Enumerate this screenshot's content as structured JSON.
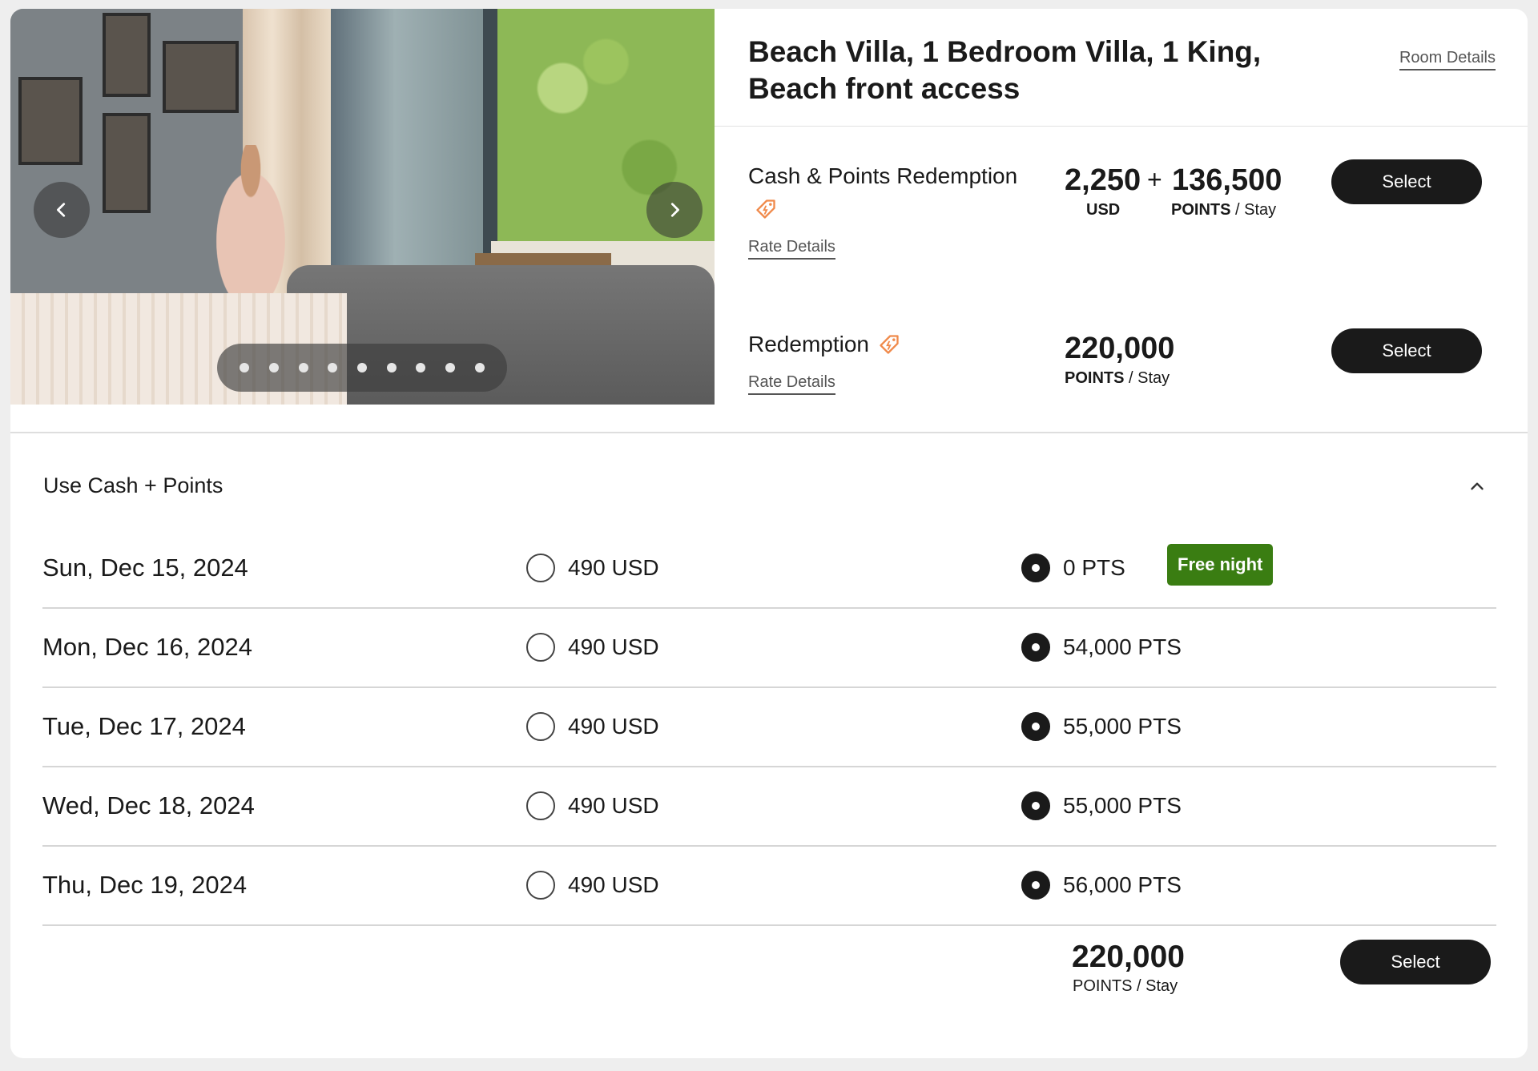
{
  "room": {
    "title_line1": "Beach Villa, 1 Bedroom Villa, 1 King,",
    "title_line2": "Beach front access",
    "details_link": "Room Details"
  },
  "carousel": {
    "prev_icon": "chevron-left-icon",
    "next_icon": "chevron-right-icon",
    "dot_count": 9
  },
  "rates": [
    {
      "name": "Cash & Points Redemption",
      "link": "Rate Details",
      "cash_amount": "2,250",
      "cash_unit": "USD",
      "plus": "+",
      "points_amount": "136,500",
      "points_unit": "POINTS",
      "per": "/ Stay",
      "button": "Select"
    },
    {
      "name": "Redemption",
      "link": "Rate Details",
      "points_amount": "220,000",
      "points_unit": "POINTS",
      "per": "/ Stay",
      "button": "Select"
    }
  ],
  "cash_points": {
    "title": "Use Cash + Points",
    "toggle_icon": "chevron-up-icon",
    "nights": [
      {
        "date": "Sun, Dec 15, 2024",
        "usd": "490 USD",
        "pts": "0 PTS",
        "badge": "Free night",
        "usd_selected": false,
        "pts_selected": true
      },
      {
        "date": "Mon, Dec 16, 2024",
        "usd": "490 USD",
        "pts": "54,000 PTS",
        "usd_selected": false,
        "pts_selected": true
      },
      {
        "date": "Tue, Dec 17, 2024",
        "usd": "490 USD",
        "pts": "55,000 PTS",
        "usd_selected": false,
        "pts_selected": true
      },
      {
        "date": "Wed, Dec 18, 2024",
        "usd": "490 USD",
        "pts": "55,000 PTS",
        "usd_selected": false,
        "pts_selected": true
      },
      {
        "date": "Thu, Dec 19, 2024",
        "usd": "490 USD",
        "pts": "56,000 PTS",
        "usd_selected": false,
        "pts_selected": true
      }
    ],
    "total_points": "220,000",
    "total_unit": "POINTS",
    "total_per": "/ Stay",
    "button": "Select"
  },
  "colors": {
    "primary_button": "#1a1a1a",
    "free_night_badge": "#3a7d12",
    "tag_icon": "#f08a4b"
  }
}
